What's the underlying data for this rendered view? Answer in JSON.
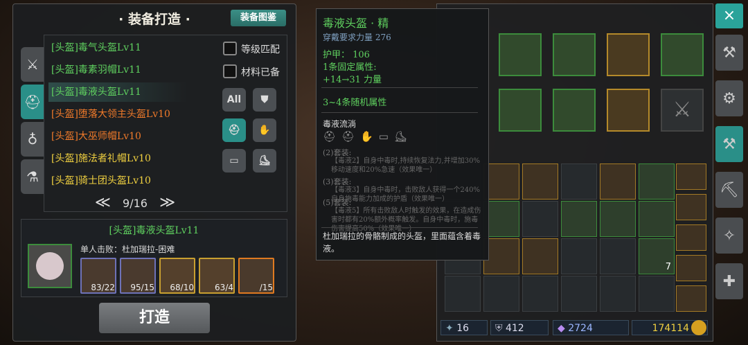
{
  "left_panel": {
    "title": "· 装备打造 ·",
    "atlas_button": "装备图鉴",
    "recipes": [
      {
        "label": "[头盔]毒气头盔Lv11",
        "color": "#5fd05f"
      },
      {
        "label": "[头盔]毒素羽帽Lv11",
        "color": "#5fd05f"
      },
      {
        "label": "[头盔]毒液头盔Lv11",
        "color": "#5fd05f"
      },
      {
        "label": "[头盔]堕落大领主头盔Lv10",
        "color": "#f07a2a"
      },
      {
        "label": "[头盔]大巫师帽Lv10",
        "color": "#f07a2a"
      },
      {
        "label": "[头盔]施法者礼帽Lv10",
        "color": "#f0d040"
      },
      {
        "label": "[头盔]骑士团头盔Lv10",
        "color": "#f0d040"
      }
    ],
    "filter_level_match": "等级匹配",
    "filter_materials_ready": "材料已备",
    "filter_all": "All",
    "page": "9/16",
    "page_prev": "≪",
    "page_next": "≫",
    "craft_item_name": "[头盔]毒液头盔Lv11",
    "craft_source": "单人击败：杜加瑞拉-困难",
    "materials": [
      "83/22",
      "95/15",
      "68/10",
      "63/4",
      "/15"
    ],
    "craft_button": "打造"
  },
  "tooltip": {
    "name": "毒液头盔 · 精",
    "requirement": "穿戴要求力量 276",
    "armor": "护甲： 106",
    "fixed_attr_title": "1条固定属性:",
    "fixed_attr": "+14→31 力量",
    "random_attr": "3~4条随机属性",
    "set_name": "毒液流淌",
    "set2_title": "(2)套装:",
    "set2_text": "【毒液2】自身中毒时,持续恢复法力,并增加30%移动速度和20%急速（效果唯一）",
    "set3_title": "(3)套装:",
    "set3_text": "【毒液3】自身中毒时，击败敌人获得一个240%自身施毒能力加成的护盾（效果唯一）",
    "set5_title": "(5)套装:",
    "set5_text": "【毒液5】所有击败敌人时触发的效果，在造成伤害时都有20%额外概率触发。自身中毒时，施毒伤害提高50%（效果唯一）",
    "description": "杜加瑞拉的骨骼制成的头盔，里面蕴含着毒液。"
  },
  "right_panel": {
    "stack_count": "7",
    "currency": {
      "attack": "16",
      "defense": "412",
      "gems": "2724",
      "gold": "174114"
    }
  },
  "icons": {
    "close": "×"
  },
  "colors": {
    "accent": "#2a8f88",
    "green": "#5fd05f",
    "orange": "#f07a2a",
    "gold": "#f0d040"
  }
}
